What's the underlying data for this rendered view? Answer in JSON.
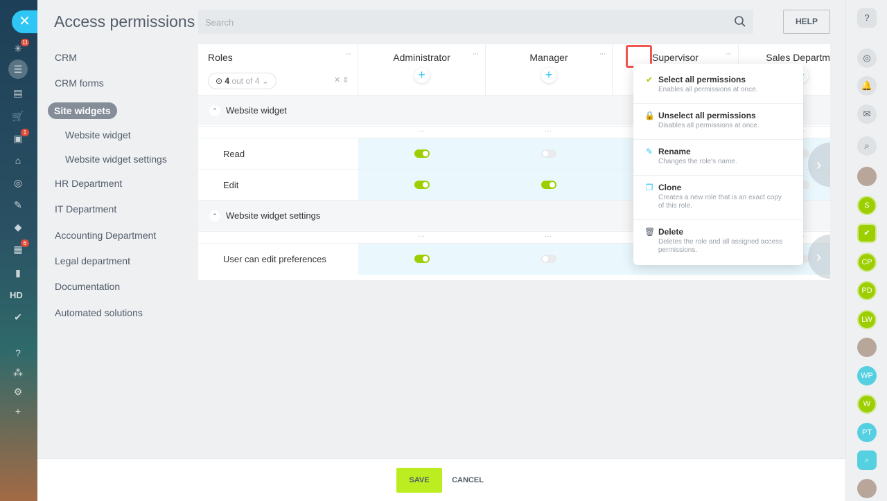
{
  "left_sidebar": {
    "close_glyph": "✕",
    "icons": [
      {
        "name": "activity-stream-icon",
        "glyph": "✳",
        "badge": "11"
      },
      {
        "name": "crm-funnel-icon",
        "glyph": "☰",
        "active": true
      },
      {
        "name": "tasks-icon",
        "glyph": "▤"
      },
      {
        "name": "shop-cart-icon",
        "glyph": "🛒"
      },
      {
        "name": "chat-bot-icon",
        "glyph": "▣",
        "badge": "1"
      },
      {
        "name": "company-icon",
        "glyph": "⌂"
      },
      {
        "name": "target-icon",
        "glyph": "◎"
      },
      {
        "name": "signature-icon",
        "glyph": "✎"
      },
      {
        "name": "box-icon",
        "glyph": "◆"
      },
      {
        "name": "documents-icon",
        "glyph": "▦",
        "badge": "6"
      },
      {
        "name": "analytics-icon",
        "glyph": "▮"
      },
      {
        "name": "check-circle-icon",
        "glyph": "✔"
      },
      {
        "name": "help-icon",
        "glyph": "?"
      },
      {
        "name": "structure-icon",
        "glyph": "⁂"
      },
      {
        "name": "settings-icon",
        "glyph": "⚙"
      },
      {
        "name": "add-icon",
        "glyph": "+"
      }
    ],
    "hd_label": "HD"
  },
  "header": {
    "title": "Access permissions",
    "search_placeholder": "Search",
    "help_label": "HELP"
  },
  "nav": {
    "items": [
      {
        "label": "CRM"
      },
      {
        "label": "CRM forms"
      },
      {
        "label": "Site widgets",
        "active": true
      },
      {
        "label": "Website widget",
        "sub": true
      },
      {
        "label": "Website widget settings",
        "sub": true
      },
      {
        "label": "HR Department"
      },
      {
        "label": "IT Department"
      },
      {
        "label": "Accounting Department"
      },
      {
        "label": "Legal department"
      },
      {
        "label": "Documentation"
      },
      {
        "label": "Automated solutions"
      }
    ]
  },
  "table": {
    "roles_title": "Roles",
    "roles_filter_count": "4",
    "roles_filter_text": "out of 4",
    "columns": [
      "Administrator",
      "Manager",
      "Supervisor",
      "Sales Departme"
    ],
    "dots": "···",
    "plus": "+",
    "sections": [
      {
        "label": "Website widget",
        "rows": [
          {
            "label": "Read",
            "values": [
              true,
              false,
              null,
              false
            ]
          },
          {
            "label": "Edit",
            "values": [
              true,
              true,
              null,
              false
            ]
          }
        ]
      },
      {
        "label": "Website widget settings",
        "rows": [
          {
            "label": "User can edit preferences",
            "values": [
              true,
              false,
              null,
              false
            ]
          }
        ]
      }
    ]
  },
  "role_menu": {
    "items": [
      {
        "title": "Select all permissions",
        "desc": "Enables all permissions at once.",
        "icon": "checkmark-icon",
        "glyph": "✔",
        "color": "#9dcf00"
      },
      {
        "title": "Unselect all permissions",
        "desc": "Disables all permissions at once.",
        "icon": "lock-icon",
        "glyph": "🔒",
        "color": "#f0554f"
      },
      {
        "title": "Rename",
        "desc": "Changes the role's name.",
        "icon": "pencil-icon",
        "glyph": "✎",
        "color": "#2fc6f6"
      },
      {
        "title": "Clone",
        "desc": "Creates a new role that is an exact copy of this role.",
        "icon": "clone-icon",
        "glyph": "❐",
        "color": "#2fc6f6"
      },
      {
        "title": "Delete",
        "desc": "Deletes the role and all assigned access permissions.",
        "icon": "trash-icon",
        "glyph": "🗑",
        "color": "#525c69"
      }
    ]
  },
  "right_sidebar": {
    "items": [
      {
        "name": "help-icon",
        "text": "?",
        "kind": "icon"
      },
      {
        "name": "copilot-icon",
        "text": "◎",
        "kind": "icon"
      },
      {
        "name": "notifications-icon",
        "text": "🔔",
        "kind": "icon"
      },
      {
        "name": "messenger-icon",
        "text": "✉",
        "kind": "icon"
      },
      {
        "name": "search-icon",
        "text": "⌕",
        "kind": "icon"
      },
      {
        "name": "user-avatar",
        "text": "",
        "kind": "avatar"
      },
      {
        "name": "user-avatar-s",
        "text": "S",
        "kind": "green"
      },
      {
        "name": "tasks-icon",
        "text": "✔",
        "kind": "green-sq"
      },
      {
        "name": "user-avatar-cp",
        "text": "CP",
        "kind": "green"
      },
      {
        "name": "user-avatar-pd",
        "text": "PD",
        "kind": "green"
      },
      {
        "name": "user-avatar-lw",
        "text": "LW",
        "kind": "green"
      },
      {
        "name": "user-avatar",
        "text": "",
        "kind": "avatar"
      },
      {
        "name": "user-avatar-wp",
        "text": "WP",
        "kind": "teal"
      },
      {
        "name": "user-avatar-w",
        "text": "W",
        "kind": "green"
      },
      {
        "name": "user-avatar-pt",
        "text": "PT",
        "kind": "teal"
      },
      {
        "name": "search-chat-icon",
        "text": "⌕",
        "kind": "teal-sq"
      },
      {
        "name": "user-avatar",
        "text": "",
        "kind": "avatar"
      }
    ]
  },
  "footer": {
    "save_label": "SAVE",
    "cancel_label": "CANCEL"
  }
}
